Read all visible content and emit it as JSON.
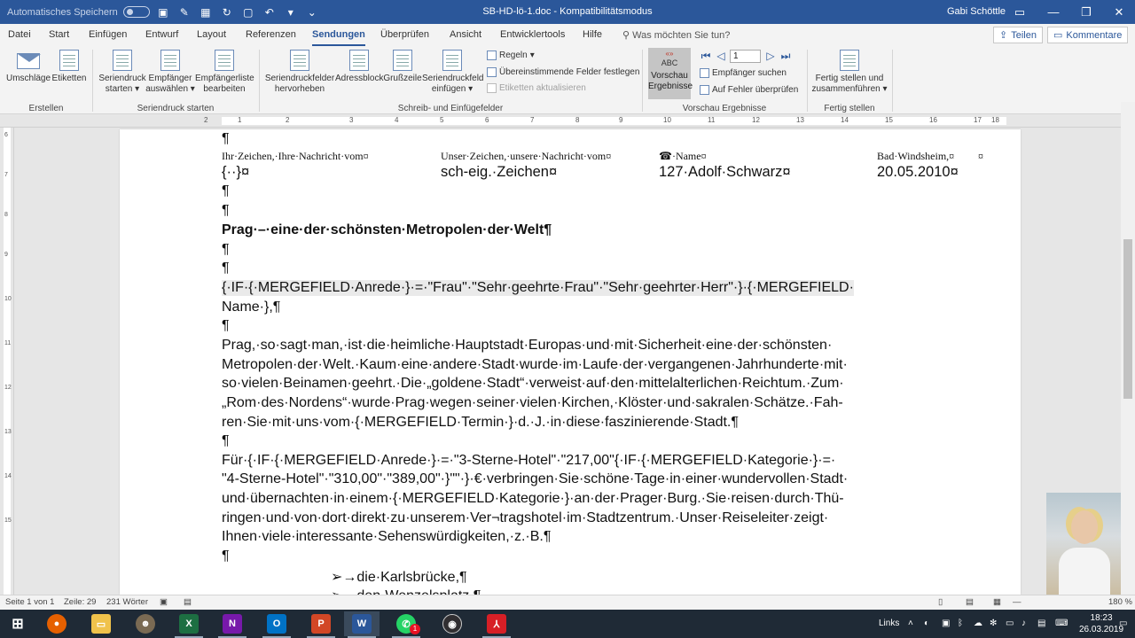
{
  "titlebar": {
    "autosave_label": "Automatisches Speichern",
    "title": "SB-HD-lö-1.doc  -  Kompatibilitätsmodus",
    "user": "Gabi Schöttle",
    "ribbon_display_icon": "ribbon-display-icon",
    "minimize_icon": "minimize-icon",
    "restore_icon": "restore-icon",
    "close_icon": "close-icon"
  },
  "tabs": [
    {
      "label": "Datei"
    },
    {
      "label": "Start"
    },
    {
      "label": "Einfügen"
    },
    {
      "label": "Entwurf"
    },
    {
      "label": "Layout"
    },
    {
      "label": "Referenzen"
    },
    {
      "label": "Sendungen"
    },
    {
      "label": "Überprüfen"
    },
    {
      "label": "Ansicht"
    },
    {
      "label": "Entwicklertools"
    },
    {
      "label": "Hilfe"
    }
  ],
  "tellme": {
    "placeholder": "Was möchten Sie tun?"
  },
  "share_label": "Teilen",
  "comments_label": "Kommentare",
  "ribbon": {
    "groups": {
      "erstellen": "Erstellen",
      "seriendruck_starten": "Seriendruck starten",
      "schreib": "Schreib- und Einfügefelder",
      "vorschau": "Vorschau Ergebnisse",
      "fertig": "Fertig stellen"
    },
    "umschlaege": "Umschläge",
    "etiketten": "Etiketten",
    "seriendruck_starten_1": "Seriendruck",
    "seriendruck_starten_2": "starten",
    "empfaenger_auswaehlen_1": "Empfänger",
    "empfaenger_auswaehlen_2": "auswählen",
    "empfaengerliste_1": "Empfängerliste",
    "empfaengerliste_2": "bearbeiten",
    "seriendruckfelder_1": "Seriendruckfelder",
    "seriendruckfelder_2": "hervorheben",
    "adressblock": "Adressblock",
    "grusszeile": "Grußzeile",
    "seriendruckfeld_1": "Seriendruckfeld",
    "seriendruckfeld_2": "einfügen",
    "regeln": "Regeln",
    "felder_festlegen": "Übereinstimmende Felder festlegen",
    "etiketten_aktualisieren": "Etiketten aktualisieren",
    "vorschau_abc_top": "«»",
    "vorschau_abc": "ABC",
    "vorschau_1": "Vorschau",
    "vorschau_2": "Ergebnisse",
    "record_number": "1",
    "empfaenger_suchen": "Empfänger suchen",
    "fehler_pruefen": "Auf Fehler überprüfen",
    "fertig_1": "Fertig stellen und",
    "fertig_2": "zusammenführen"
  },
  "ruler": {
    "h_numbers": [
      "2",
      "1",
      "1",
      "2",
      "3",
      "4",
      "5",
      "6",
      "7",
      "8",
      "9",
      "10",
      "11",
      "12",
      "13",
      "14",
      "15",
      "16",
      "17",
      "18"
    ],
    "v_numbers": [
      "6",
      "7",
      "8",
      "9",
      "10",
      "11",
      "12",
      "13",
      "14",
      "15"
    ]
  },
  "document": {
    "pilcrow": "¶",
    "ref_ihr": "Ihr·Zeichen,·Ihre·Nachricht·vom¤",
    "ref_unser": "Unser·Zeichen,·unsere·Nachricht·vom¤",
    "ref_name": "☎·Name¤",
    "ref_ort": "Bad·Windsheim,¤",
    "cell_marker": "¤",
    "val_ihr": "{··}¤",
    "val_unser": "sch-eig.·Zeichen¤",
    "val_name": "127·Adolf·Schwarz¤",
    "val_datum": "20.05.2010¤",
    "heading": "Prag·–·eine·der·schönsten·Metropolen·der·Welt¶",
    "salutation_1": "{·IF·{·MERGEFIELD·Anrede·}·=·\"Frau\"·\"Sehr·geehrte·Frau\"·\"Sehr·geehrter·Herr\"·}·{·MERGEFIELD·",
    "salutation_2": "Name·},¶",
    "para1_l1": "Prag,·so·sagt·man,·ist·die·heimliche·Hauptstadt·Europas·und·mit·Sicherheit·eine·der·schönsten·",
    "para1_l2": "Metropolen·der·Welt.·Kaum·eine·andere·Stadt·wurde·im·Laufe·der·vergangenen·Jahrhunderte·mit·",
    "para1_l3": "so·vielen·Beinamen·geehrt.·Die·„goldene·Stadt“·verweist·auf·den·mittelalterlichen·Reichtum.·Zum·",
    "para1_l4": "„Rom·des·Nordens“·wurde·Prag·wegen·seiner·vielen·Kirchen,·Klöster·und·sakralen·Schätze.·Fah-",
    "para1_l5": "ren·Sie·mit·uns·vom·{·MERGEFIELD·Termin·}·d.·J.·in·diese·faszinierende·Stadt.¶",
    "para2_l1": "Für·{·IF·{·MERGEFIELD·Anrede·}·=·\"3-Sterne-Hotel\"·\"217,00\"{·IF·{·MERGEFIELD·Kategorie·}·=·",
    "para2_l2": "\"4-Sterne-Hotel\"·\"310,00\"·\"389,00\"·}\"\"·}·€·verbringen·Sie·schöne·Tage·in·einer·wundervollen·Stadt·",
    "para2_l3": "und·übernachten·in·einem·{·MERGEFIELD·Kategorie·}·an·der·Prager·Burg.·Sie·reisen·durch·Thü-",
    "para2_l4": "ringen·und·von·dort·direkt·zu·unserem·Ver¬tragshotel·im·Stadtzentrum.·Unser·Reiseleiter·zeigt·",
    "para2_l5": "Ihnen·viele·interessante·Sehenswürdigkeiten,·z.·B.¶",
    "bullet_1": "➢→die·Karlsbrücke,¶",
    "bullet_2": "➢→den·Wenzelsplatz,¶"
  },
  "statusbar": {
    "page": "Seite 1 von 1",
    "line": "Zeile: 29",
    "words": "231 Wörter",
    "zoom": "180 %"
  },
  "taskbar": {
    "links_label": "Links",
    "time": "18:23",
    "date": "26.03.2019",
    "notification_badge": "1",
    "apps": [
      {
        "icon": "windows-start-icon"
      },
      {
        "icon": "firefox-icon"
      },
      {
        "icon": "file-explorer-icon"
      },
      {
        "icon": "gimp-icon"
      },
      {
        "icon": "excel-icon"
      },
      {
        "icon": "onenote-icon"
      },
      {
        "icon": "outlook-icon"
      },
      {
        "icon": "powerpoint-icon"
      },
      {
        "icon": "word-icon"
      },
      {
        "icon": "whatsapp-icon"
      },
      {
        "icon": "obs-icon"
      },
      {
        "icon": "acrobat-icon"
      }
    ]
  },
  "colors": {
    "word_blue": "#2b579a",
    "taskbar": "#1f2a36",
    "field_shading": "#eaeaea"
  }
}
